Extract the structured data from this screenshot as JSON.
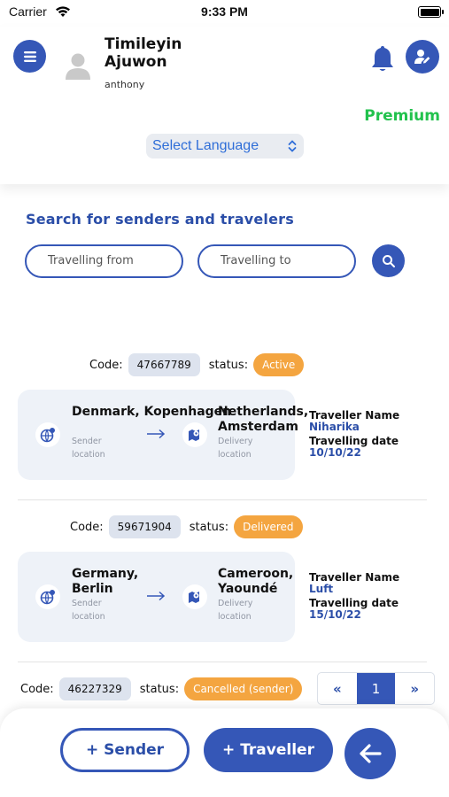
{
  "status_bar": {
    "carrier": "Carrier",
    "time": "9:33 PM"
  },
  "header": {
    "user_name": "Timileyin Ajuwon",
    "user_handle": "anthony",
    "premium_label": "Premium",
    "language_select": "Select Language"
  },
  "search": {
    "title": "Search for senders and travelers",
    "from_placeholder": "Travelling from",
    "to_placeholder": "Travelling to"
  },
  "labels": {
    "code": "Code:",
    "status": "status:",
    "sender_location": "Sender location",
    "delivery_location": "Delivery location",
    "traveller_name": "Traveller Name",
    "travelling_date": "Travelling date"
  },
  "shipments": [
    {
      "code": "47667789",
      "status": "Active",
      "sender_location": "Denmark, Kopenhagen",
      "delivery_location": "Netherlands, Amsterdam",
      "traveller_name": "Niharika",
      "travelling_date": "10/10/22"
    },
    {
      "code": "59671904",
      "status": "Delivered",
      "sender_location": "Germany, Berlin",
      "delivery_location": "Cameroon, Yaoundé",
      "traveller_name": "Luft",
      "travelling_date": "15/10/22"
    },
    {
      "code": "46227329",
      "status": "Cancelled (sender)"
    }
  ],
  "pagination": {
    "prev": "«",
    "current": "1",
    "next": "»"
  },
  "bottom": {
    "sender_button": "+ Sender",
    "traveller_button": "+ Traveller"
  },
  "colors": {
    "primary": "#3557b7",
    "premium": "#22c24d",
    "status_badge": "#f4a540",
    "card_bg": "#eef2f8"
  }
}
